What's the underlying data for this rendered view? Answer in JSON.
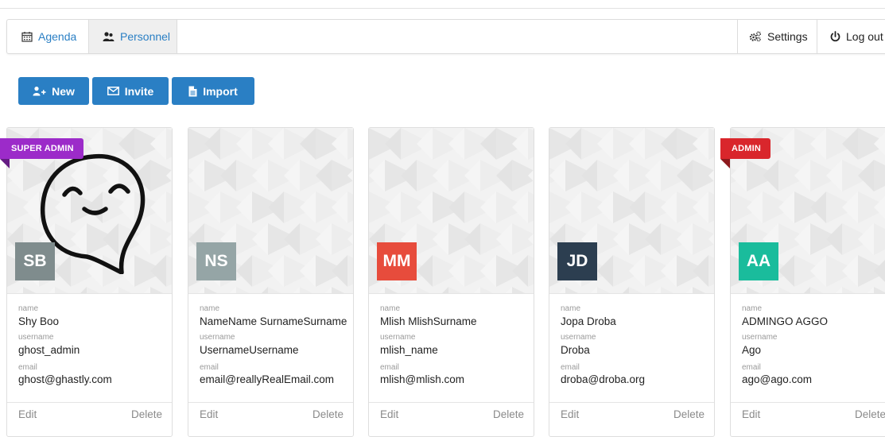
{
  "nav": {
    "agenda": "Agenda",
    "personnel": "Personnel",
    "settings": "Settings",
    "logout": "Log out"
  },
  "actions": {
    "new": "New",
    "invite": "Invite",
    "import": "Import"
  },
  "field_labels": {
    "name": "name",
    "username": "username",
    "email": "email"
  },
  "card_actions": {
    "edit": "Edit",
    "delete": "Delete"
  },
  "users": [
    {
      "initials": "SB",
      "name": "Shy Boo",
      "username": "ghost_admin",
      "email": "ghost@ghastly.com",
      "badge": "SUPER ADMIN",
      "avatar_color": "#7f8c8d",
      "badge_color": "#9c2bc9"
    },
    {
      "initials": "NS",
      "name": "NameName SurnameSurname",
      "username": "UsernameUsername",
      "email": "email@reallyRealEmail.com",
      "avatar_color": "#95a5a6"
    },
    {
      "initials": "MM",
      "name": "Mlish MlishSurname",
      "username": "mlish_name",
      "email": "mlish@mlish.com",
      "avatar_color": "#e74c3c"
    },
    {
      "initials": "JD",
      "name": "Jopa Droba",
      "username": "Droba",
      "email": "droba@droba.org",
      "avatar_color": "#2c3e50"
    },
    {
      "initials": "AA",
      "name": "ADMINGO AGGO",
      "username": "Ago",
      "email": "ago@ago.com",
      "badge": "ADMIN",
      "avatar_color": "#1abc9c",
      "badge_color": "#d9262c"
    }
  ],
  "colors": {
    "primary": "#2a7fc4",
    "nav_active_bg": "#efefef"
  }
}
